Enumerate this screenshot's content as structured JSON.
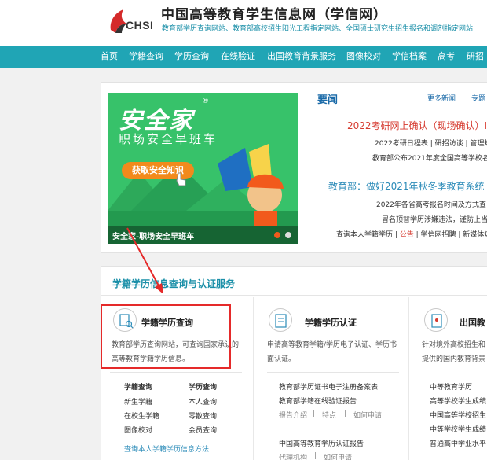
{
  "header": {
    "logo_text": "CHSI",
    "title": "中国高等教育学生信息网（学信网）",
    "subtitle": "教育部学历查询网站、教育部高校招生阳光工程指定网站、全国硕士研究生招生报名和调剂指定网站"
  },
  "nav": {
    "items": [
      "首页",
      "学籍查询",
      "学历查询",
      "在线验证",
      "出国教育背景服务",
      "图像校对",
      "学信档案",
      "高考",
      "研招"
    ]
  },
  "banner": {
    "title": "安全家",
    "registered": "®",
    "subtitle": "职场安全早班车",
    "button": "获取安全知识",
    "caption": "安全家-职场安全早班车",
    "colors": {
      "bg": "#37c26a",
      "active_dot": "#f25a1c"
    }
  },
  "news": {
    "title": "要闻",
    "more": "更多新闻",
    "sep": "|",
    "tab2": "专题",
    "headline1": "2022考研网上确认（现场确认）I",
    "row1": "2022考研日程表 | 研招访谈 | 管理规",
    "row2": "教育部公布2021年度全国高等学校名",
    "headline2": "教育部：做好2021年秋冬季教育系统",
    "row3": "2022年各省高考报名时间及方式查",
    "row4": "冒名顶替学历涉嫌违法，谨防上当受骗",
    "row5_a": "查询本人学籍学历 | ",
    "row5_b": "公告",
    "row5_c": " | 学信网招聘 | 新媒体矩"
  },
  "services": {
    "section_title": "学籍学历信息查询与认证服务",
    "col1": {
      "icon": "search-icon",
      "title": "学籍学历查询",
      "desc": "教育部学历查询网站，可查询国家承认的高等教育学籍学历信息。",
      "h1": "学籍查询",
      "h2": "学历查询",
      "a1": "新生学籍",
      "a2": "在校生学籍",
      "a3": "图像校对",
      "b1": "本人查询",
      "b2": "零散查询",
      "b3": "会员查询",
      "footer": "查询本人学籍学历信息方法"
    },
    "col2": {
      "icon": "certificate-icon",
      "title": "学籍学历认证",
      "desc": "申请高等教育学籍/学历电子认证、学历书面认证。",
      "l1": "教育部学历证书电子注册备案表",
      "l2": "教育部学籍在线验证报告",
      "l3a": "报告介绍",
      "l3b": "特点",
      "l3c": "如何申请",
      "l4": "中国高等教育学历认证报告",
      "l5a": "代理机构",
      "l5b": "如何申请",
      "sep": "|"
    },
    "col3": {
      "icon": "document-icon",
      "title": "出国教",
      "desc1": "针对境外高校招生和",
      "desc2": "提供的国内教育背景",
      "l1": "中等教育学历",
      "l2": "高等学校学生成绩",
      "l3": "中国高等学校招生",
      "l4": "中等学校学生成绩",
      "l5": "普通高中学业水平"
    }
  }
}
